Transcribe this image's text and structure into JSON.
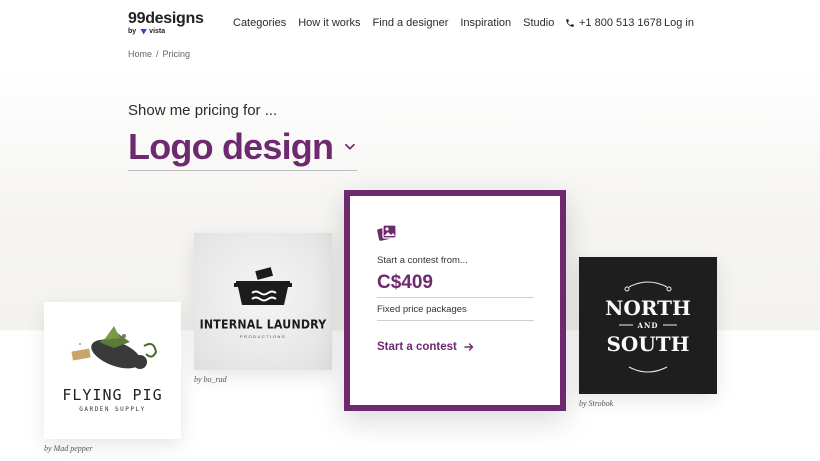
{
  "header": {
    "logo": "99designs",
    "logo_sub_by": "by",
    "logo_sub_brand": "vista",
    "nav": [
      "Categories",
      "How it works",
      "Find a designer",
      "Inspiration",
      "Studio"
    ],
    "phone": "+1 800 513 1678",
    "login": "Log in"
  },
  "breadcrumb": {
    "home": "Home",
    "separator": "/",
    "current": "Pricing"
  },
  "hero": {
    "prompt": "Show me pricing for ...",
    "category": "Logo design",
    "category_icon": "chevron-down-icon"
  },
  "pricing_card": {
    "icon": "gallery-icon",
    "start_text": "Start a contest from...",
    "price": "C$409",
    "packages_text": "Fixed price packages",
    "cta": "Start a contest",
    "cta_icon": "arrow-right-icon"
  },
  "examples": [
    {
      "title": "FLYING PIG",
      "subtitle": "GARDEN SUPPLY",
      "credit": "by Mad pepper"
    },
    {
      "title": "INTERNAL LAUNDRY",
      "subtitle": "PRODUCTIONS",
      "credit": "by bo_rad"
    },
    {
      "word1": "NORTH",
      "word2": "AND",
      "word3": "SOUTH",
      "credit": "by Strobok"
    }
  ],
  "colors": {
    "brand_purple": "#6e2a6e",
    "text": "#2b2b2b",
    "dark_card": "#1e1e1e"
  }
}
